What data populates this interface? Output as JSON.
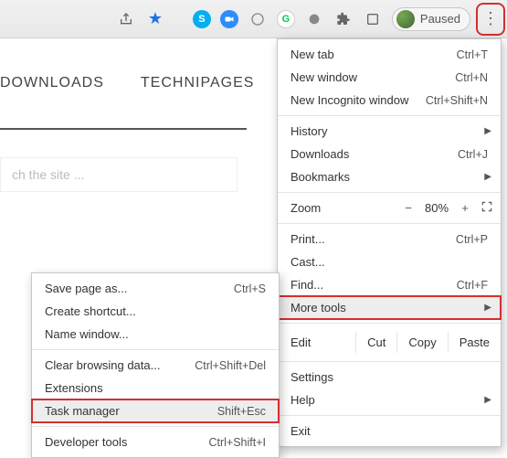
{
  "toolbar": {
    "paused_label": "Paused"
  },
  "page": {
    "tab1": "DOWNLOADS",
    "tab2": "TECHNIPAGES",
    "search_placeholder": "ch the site ..."
  },
  "menu": {
    "new_tab": {
      "label": "New tab",
      "shortcut": "Ctrl+T"
    },
    "new_window": {
      "label": "New window",
      "shortcut": "Ctrl+N"
    },
    "incognito": {
      "label": "New Incognito window",
      "shortcut": "Ctrl+Shift+N"
    },
    "history": {
      "label": "History"
    },
    "downloads": {
      "label": "Downloads",
      "shortcut": "Ctrl+J"
    },
    "bookmarks": {
      "label": "Bookmarks"
    },
    "zoom": {
      "label": "Zoom",
      "minus": "−",
      "pct": "80%",
      "plus": "+"
    },
    "print": {
      "label": "Print...",
      "shortcut": "Ctrl+P"
    },
    "cast": {
      "label": "Cast..."
    },
    "find": {
      "label": "Find...",
      "shortcut": "Ctrl+F"
    },
    "more_tools": {
      "label": "More tools"
    },
    "edit": {
      "label": "Edit",
      "cut": "Cut",
      "copy": "Copy",
      "paste": "Paste"
    },
    "settings": {
      "label": "Settings"
    },
    "help": {
      "label": "Help"
    },
    "exit": {
      "label": "Exit"
    }
  },
  "submenu": {
    "save_page": {
      "label": "Save page as...",
      "shortcut": "Ctrl+S"
    },
    "create_shortcut": {
      "label": "Create shortcut..."
    },
    "name_window": {
      "label": "Name window..."
    },
    "clear_data": {
      "label": "Clear browsing data...",
      "shortcut": "Ctrl+Shift+Del"
    },
    "extensions": {
      "label": "Extensions"
    },
    "task_manager": {
      "label": "Task manager",
      "shortcut": "Shift+Esc"
    },
    "dev_tools": {
      "label": "Developer tools",
      "shortcut": "Ctrl+Shift+I"
    }
  }
}
